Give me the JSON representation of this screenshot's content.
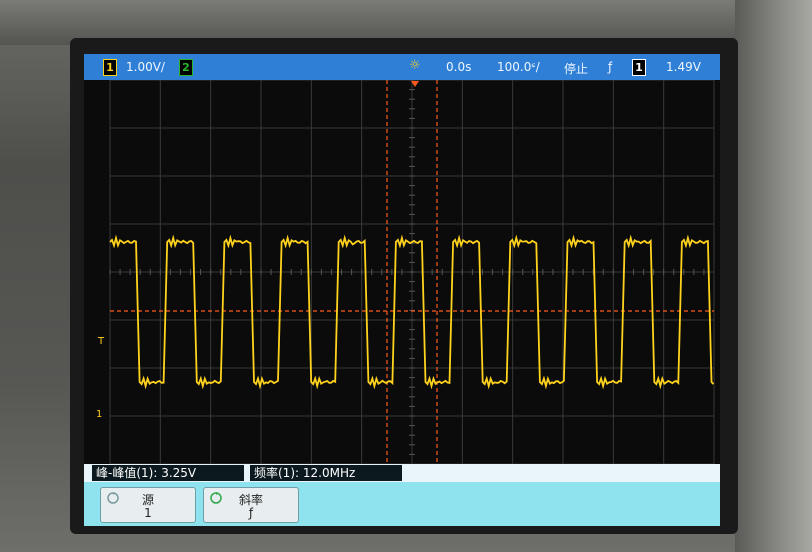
{
  "colors": {
    "trace": "#ffd21e",
    "cursor": "#ff5a1e",
    "status_bar": "#2f7fd6",
    "channel2": "#2bb52b"
  },
  "status_bar": {
    "channel1_label": "1",
    "channel1_scale": "1.00V/",
    "channel2_label": "2",
    "trigger_icon": "☼",
    "time_offset": "0.0s",
    "time_scale": "100.0ᶝ/",
    "run_state": "停止",
    "trigger_slope_icon": "ƒ",
    "trigger_source": "1",
    "trigger_level": "1.49V"
  },
  "markers": {
    "trigger_level_marker": "T",
    "ground_marker": "1"
  },
  "measurements": [
    {
      "label": "峰-峰值(1):",
      "value": "3.25V"
    },
    {
      "label": "频率(1):",
      "value": "12.0MHz"
    }
  ],
  "softkeys": [
    {
      "label": "源",
      "value": "1",
      "icon": "rotate-knob-icon"
    },
    {
      "label": "斜率",
      "value": "ƒ",
      "icon": "rotate-knob-icon"
    }
  ],
  "signal": {
    "waveform": "square",
    "frequency": "12.0MHz",
    "peak_to_peak": "3.25V",
    "visible_cycles": 11.8
  }
}
